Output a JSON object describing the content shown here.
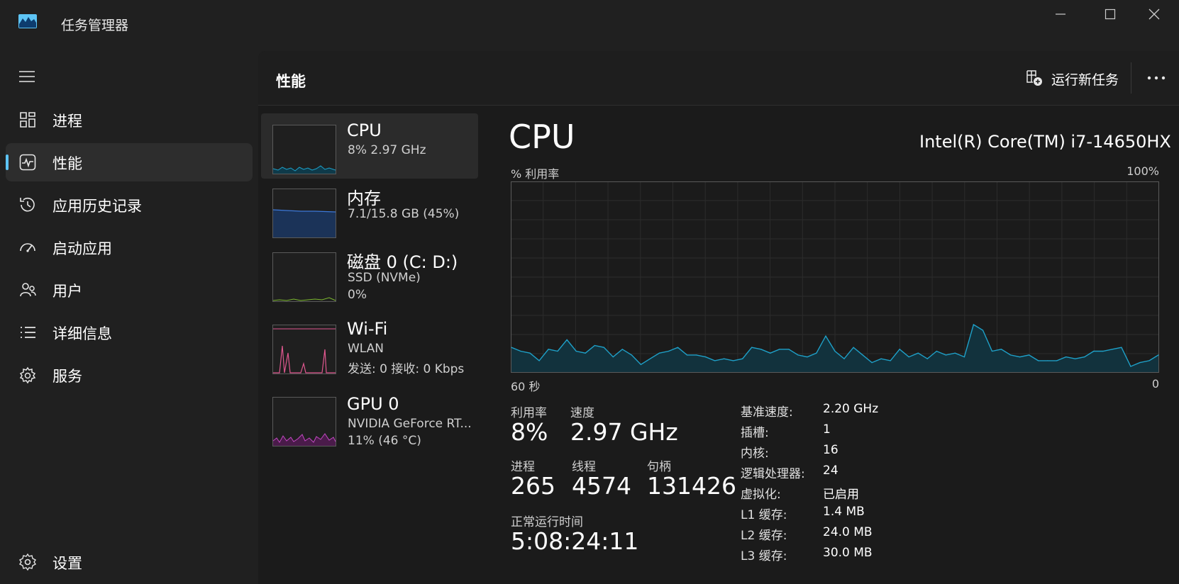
{
  "app": {
    "title": "任务管理器"
  },
  "nav": {
    "items": [
      {
        "label": "进程",
        "icon": "processes-icon"
      },
      {
        "label": "性能",
        "icon": "performance-icon",
        "active": true
      },
      {
        "label": "应用历史记录",
        "icon": "history-icon"
      },
      {
        "label": "启动应用",
        "icon": "startup-icon"
      },
      {
        "label": "用户",
        "icon": "users-icon"
      },
      {
        "label": "详细信息",
        "icon": "details-icon"
      },
      {
        "label": "服务",
        "icon": "services-icon"
      }
    ],
    "settings": {
      "label": "设置",
      "icon": "gear-icon"
    }
  },
  "header": {
    "title": "性能",
    "run_task": "运行新任务"
  },
  "devices": [
    {
      "name": "CPU",
      "line1": "8%  2.97 GHz",
      "color": "#1ea0c8"
    },
    {
      "name": "内存",
      "line1": "7.1/15.8 GB (45%)",
      "color": "#3c78d8"
    },
    {
      "name": "磁盘 0 (C: D:)",
      "line1": "SSD (NVMe)",
      "line2": "0%",
      "color": "#7cb82f"
    },
    {
      "name": "Wi-Fi",
      "line1": "WLAN",
      "line2": "发送: 0 接收: 0 Kbps",
      "color": "#e0578f"
    },
    {
      "name": "GPU 0",
      "line1": "NVIDIA GeForce RT...",
      "line2": "11% (46 °C)",
      "color": "#c248c2"
    }
  ],
  "detail": {
    "title": "CPU",
    "model": "Intel(R) Core(TM) i7-14650HX",
    "graph_label": "% 利用率",
    "graph_max": "100%",
    "x_left": "60 秒",
    "x_right": "0",
    "utilization": {
      "label": "利用率",
      "value": "8%"
    },
    "speed": {
      "label": "速度",
      "value": "2.97 GHz"
    },
    "processes": {
      "label": "进程",
      "value": "265"
    },
    "threads": {
      "label": "线程",
      "value": "4574"
    },
    "handles": {
      "label": "句柄",
      "value": "131426"
    },
    "uptime": {
      "label": "正常运行时间",
      "value": "5:08:24:11"
    },
    "specs": [
      {
        "k": "基准速度:",
        "v": "2.20 GHz"
      },
      {
        "k": "插槽:",
        "v": "1"
      },
      {
        "k": "内核:",
        "v": "16"
      },
      {
        "k": "逻辑处理器:",
        "v": "24"
      },
      {
        "k": "虚拟化:",
        "v": "已启用"
      },
      {
        "k": "L1 缓存:",
        "v": "1.4 MB"
      },
      {
        "k": "L2 缓存:",
        "v": "24.0 MB"
      },
      {
        "k": "L3 缓存:",
        "v": "30.0 MB"
      }
    ]
  },
  "chart_data": {
    "type": "area",
    "ylabel": "% 利用率",
    "ylim": [
      0,
      100
    ],
    "x_range_seconds": [
      60,
      0
    ],
    "values": [
      13,
      11,
      10,
      6,
      12,
      11,
      17,
      11,
      10,
      14,
      13,
      8,
      12,
      9,
      4,
      7,
      10,
      11,
      13,
      9,
      9,
      8,
      6,
      7,
      6,
      7,
      13,
      12,
      10,
      12,
      12,
      9,
      8,
      10,
      19,
      11,
      7,
      13,
      9,
      5,
      7,
      6,
      12,
      8,
      10,
      7,
      11,
      9,
      10,
      8,
      25,
      22,
      11,
      12,
      9,
      8,
      9,
      6,
      6,
      6,
      8,
      7,
      8,
      11,
      11,
      12,
      13,
      3,
      5,
      6,
      9
    ]
  }
}
